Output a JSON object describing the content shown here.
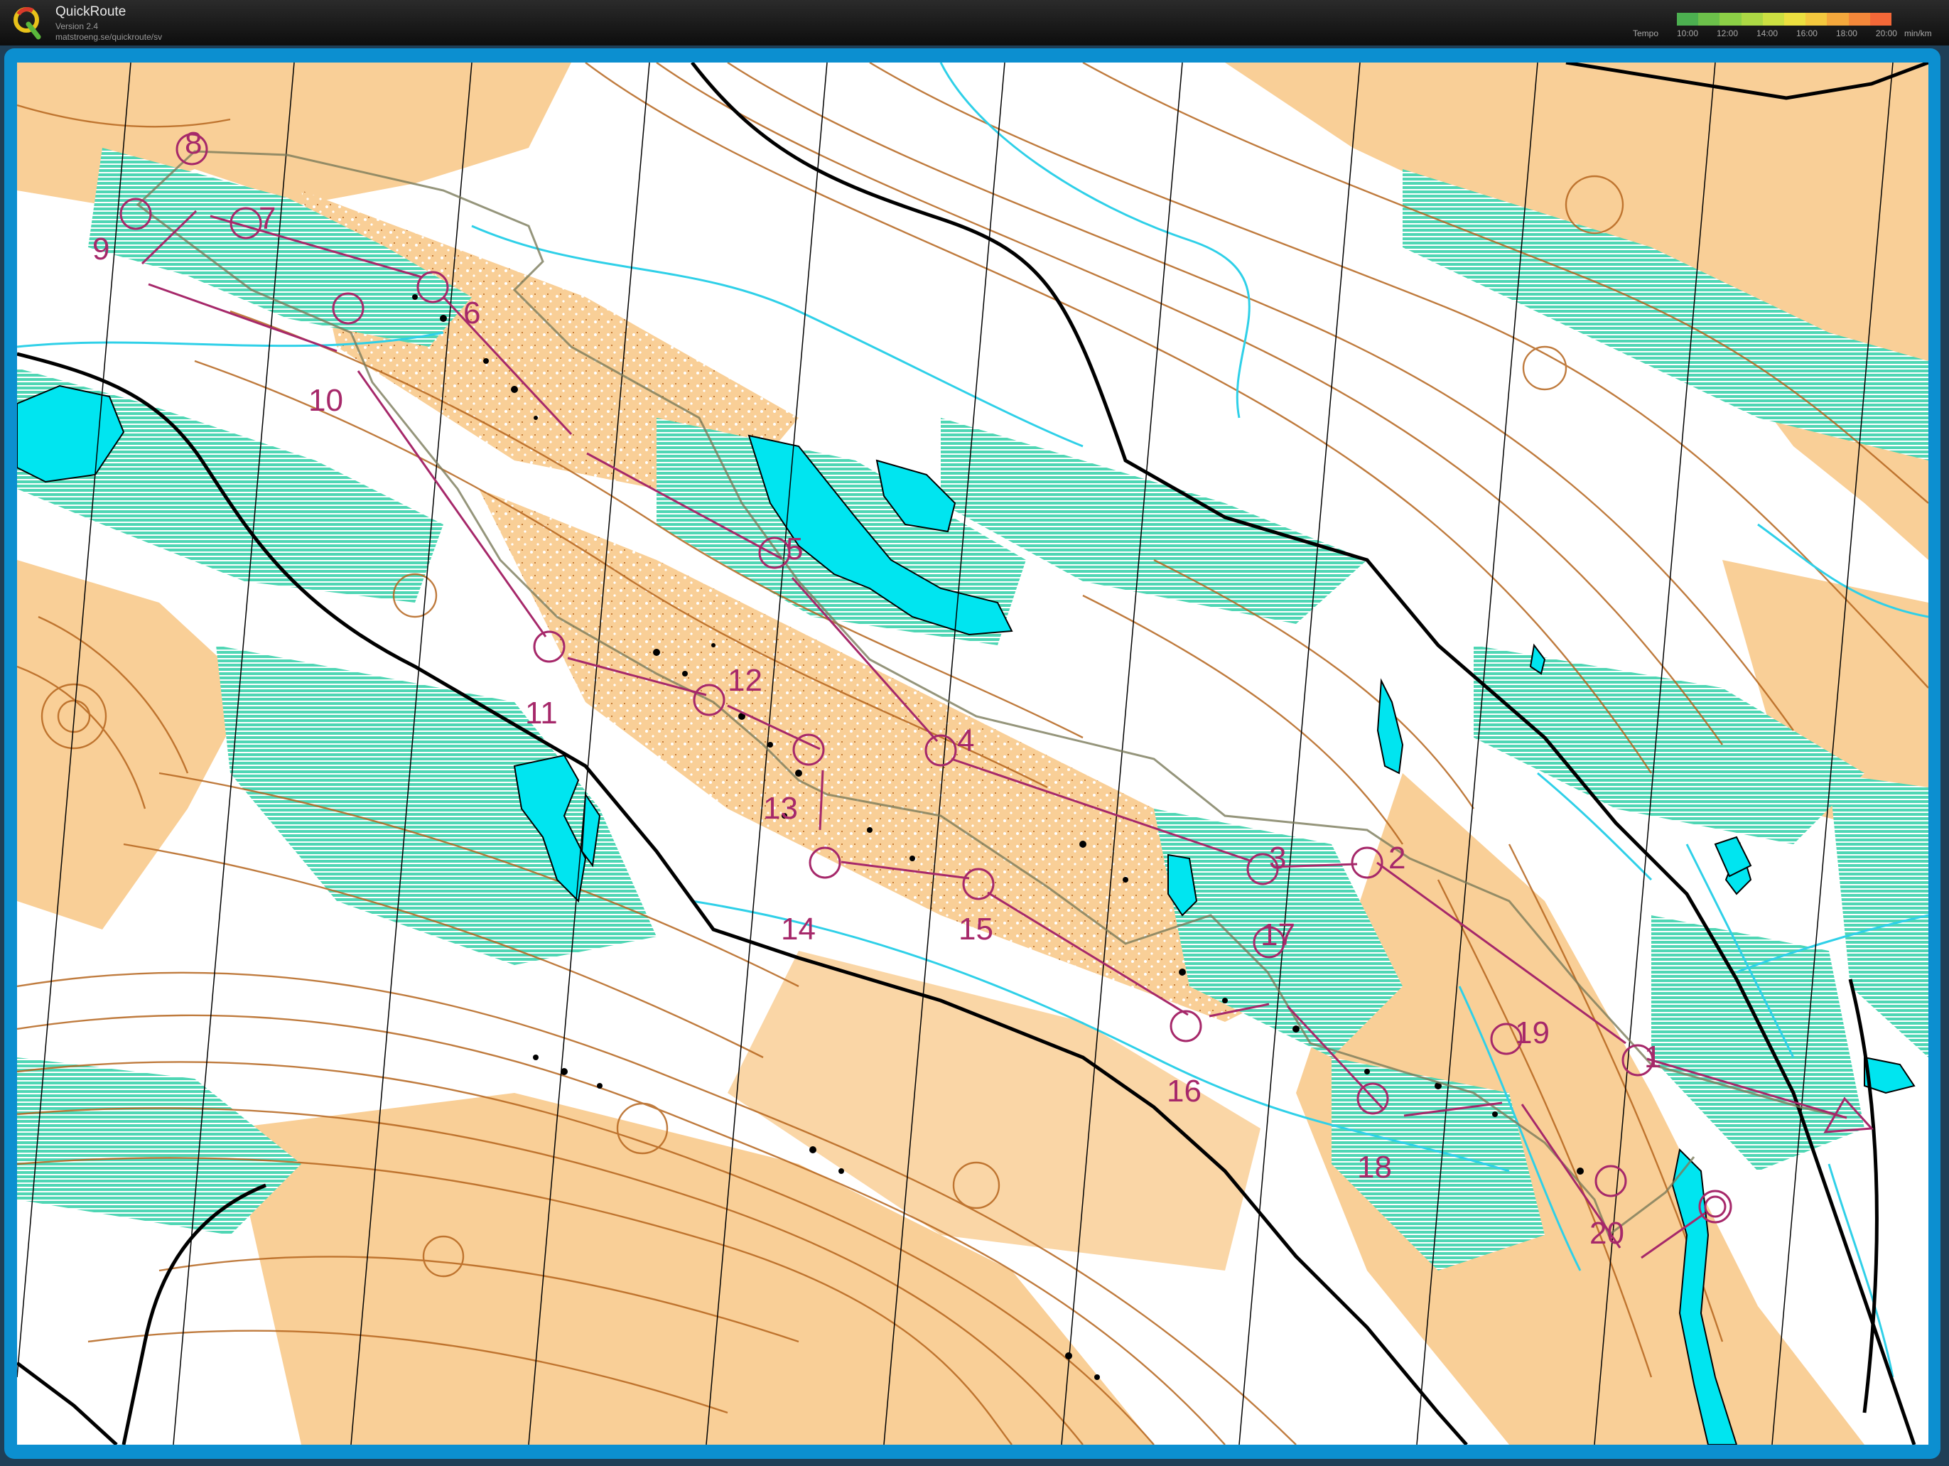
{
  "app": {
    "title": "QuickRoute",
    "version": "Version 2.4",
    "url": "matstroeng.se/quickroute/sv"
  },
  "tempo": {
    "label": "Tempo",
    "ticks": [
      "10:00",
      "12:00",
      "14:00",
      "16:00",
      "18:00",
      "20:00"
    ],
    "unit": "min/km",
    "colors": [
      "#4caf50",
      "#6cc04a",
      "#8cd046",
      "#acd844",
      "#cce042",
      "#ece040",
      "#f4c83e",
      "#f4a83c",
      "#f4883a",
      "#f46838"
    ]
  },
  "colors": {
    "course": "#a6286a",
    "route": "#7a7a5a",
    "water": "#00e5f0",
    "open_land": "#f9cf97",
    "vegetation": "#4fd6b4",
    "contour": "#b5651d",
    "road": "#000000"
  },
  "controls": [
    {
      "label": "1"
    },
    {
      "label": "2"
    },
    {
      "label": "3"
    },
    {
      "label": "4"
    },
    {
      "label": "5"
    },
    {
      "label": "6"
    },
    {
      "label": "7"
    },
    {
      "label": "8"
    },
    {
      "label": "9"
    },
    {
      "label": "10"
    },
    {
      "label": "11"
    },
    {
      "label": "12"
    },
    {
      "label": "13"
    },
    {
      "label": "14"
    },
    {
      "label": "15"
    },
    {
      "label": "16"
    },
    {
      "label": "17"
    },
    {
      "label": "18"
    },
    {
      "label": "19"
    },
    {
      "label": "20"
    }
  ]
}
